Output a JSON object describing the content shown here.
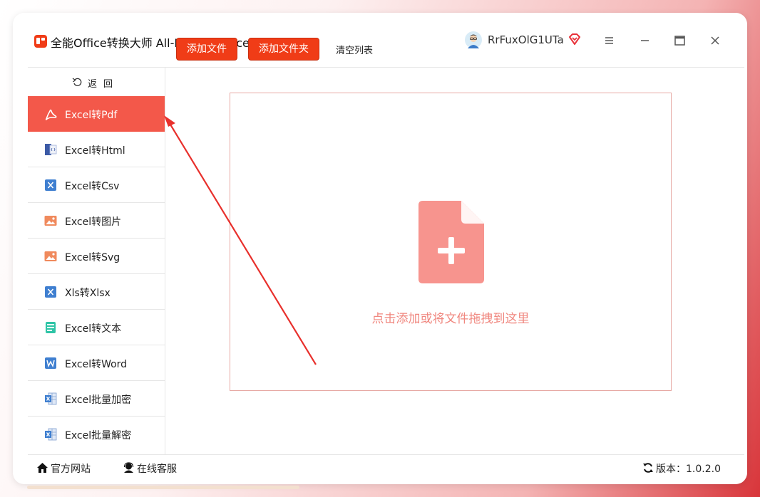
{
  "app": {
    "title": "全能Office转换大师 All-In-One Office Master",
    "username": "RrFuxOlG1UTa",
    "brand_color": "#f03c17"
  },
  "sidebar": {
    "back_label": "返回",
    "items": [
      {
        "label": "Excel转Pdf",
        "icon": "pdf-icon",
        "active": true
      },
      {
        "label": "Excel转Html",
        "icon": "html-icon"
      },
      {
        "label": "Excel转Csv",
        "icon": "excel-x-icon"
      },
      {
        "label": "Excel转图片",
        "icon": "image-icon"
      },
      {
        "label": "Excel转Svg",
        "icon": "image-icon"
      },
      {
        "label": "Xls转Xlsx",
        "icon": "excel-x-icon"
      },
      {
        "label": "Excel转文本",
        "icon": "text-doc-icon"
      },
      {
        "label": "Excel转Word",
        "icon": "word-icon"
      },
      {
        "label": "Excel批量加密",
        "icon": "excel-sheet-icon"
      },
      {
        "label": "Excel批量解密",
        "icon": "excel-sheet-icon"
      }
    ]
  },
  "toolbar": {
    "add_file": "添加文件",
    "add_folder": "添加文件夹",
    "clear_list": "清空列表"
  },
  "dropzone": {
    "hint": "点击添加或将文件拖拽到这里",
    "icon": "add-file-icon"
  },
  "footer": {
    "website": "官方网站",
    "support": "在线客服",
    "version": "版本：1.0.2.0"
  }
}
